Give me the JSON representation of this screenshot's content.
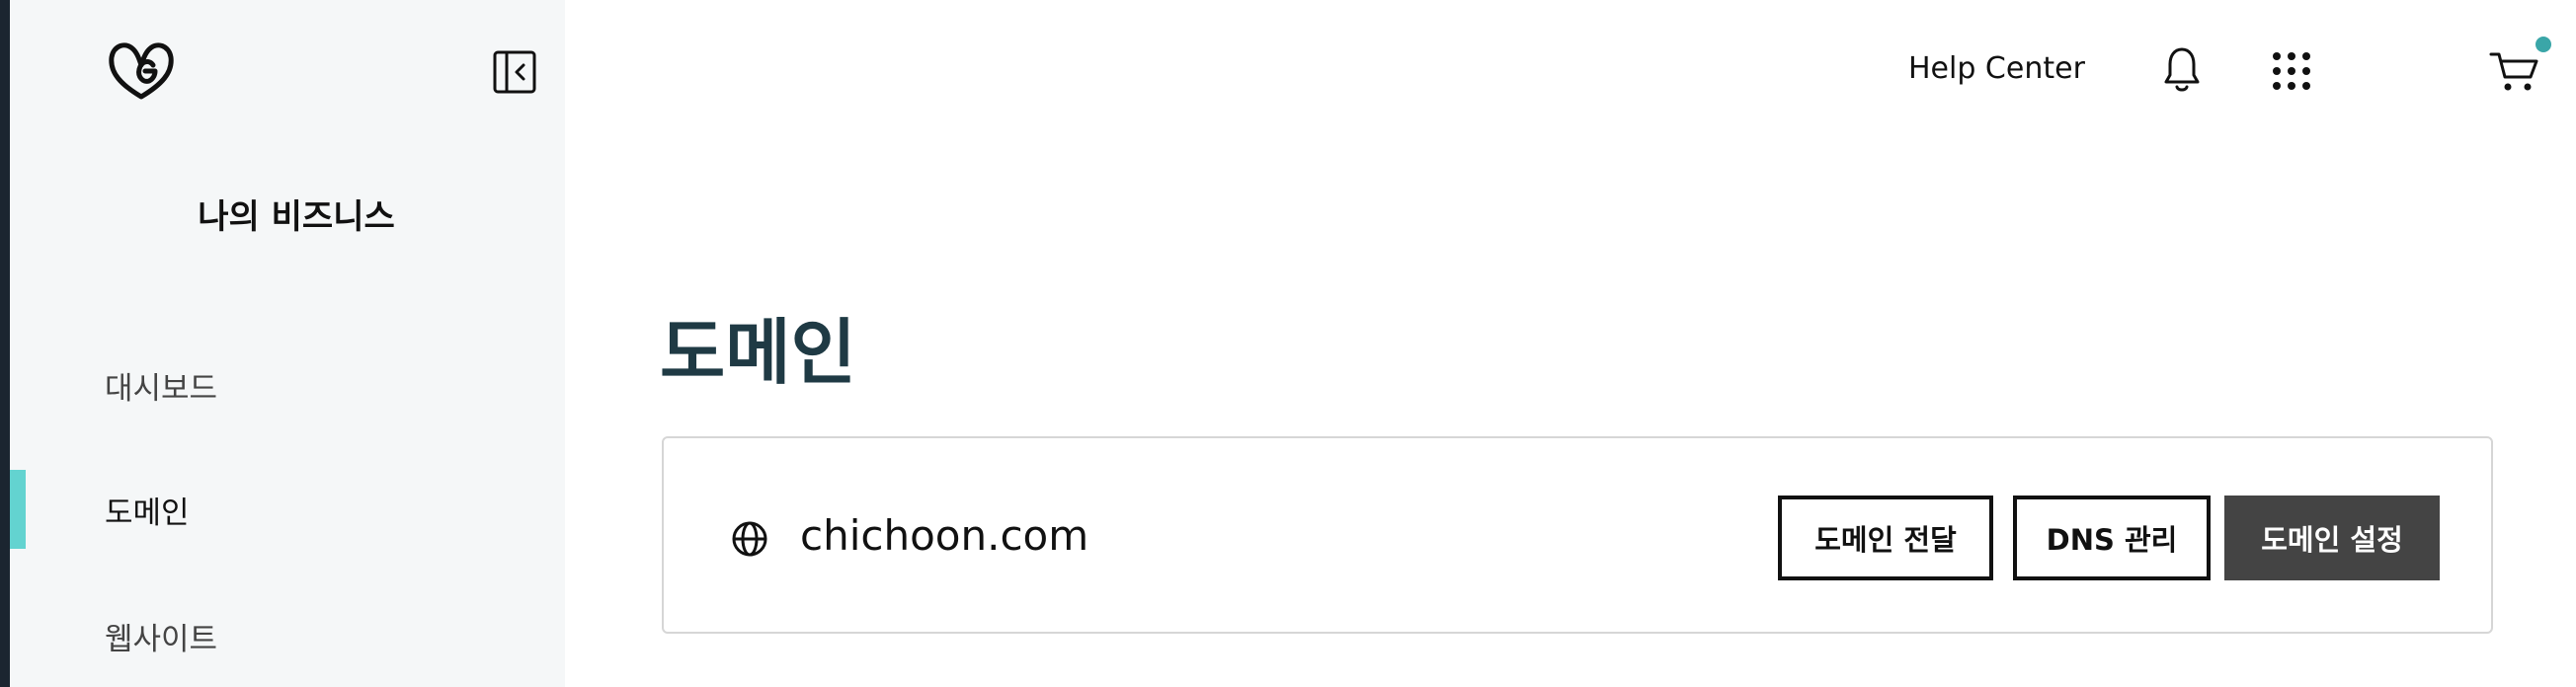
{
  "sidebar": {
    "logo_icon": "godaddy-logo-icon",
    "collapse_icon": "sidebar-collapse-icon",
    "business_title": "나의 비즈니스",
    "nav_items": [
      {
        "label": "대시보드",
        "active": false
      },
      {
        "label": "도메인",
        "active": true
      },
      {
        "label": "웹사이트",
        "active": false
      }
    ]
  },
  "header": {
    "help_link": "Help Center",
    "notification_icon": "bell-icon",
    "apps_icon": "grid-icon",
    "cart_icon": "cart-icon",
    "cart_badge_color": "#3aa6a8"
  },
  "main": {
    "title": "도메인",
    "domains": [
      {
        "icon": "globe-icon",
        "name": "chichoon.com",
        "actions": {
          "forward": "도메인 전달",
          "dns": "DNS 관리",
          "settings": "도메인 설정"
        }
      }
    ]
  },
  "colors": {
    "accent": "#63d3d0",
    "title_color": "#1f3a44",
    "primary_button": "#444444",
    "sidebar_bg": "#f5f7f8"
  }
}
